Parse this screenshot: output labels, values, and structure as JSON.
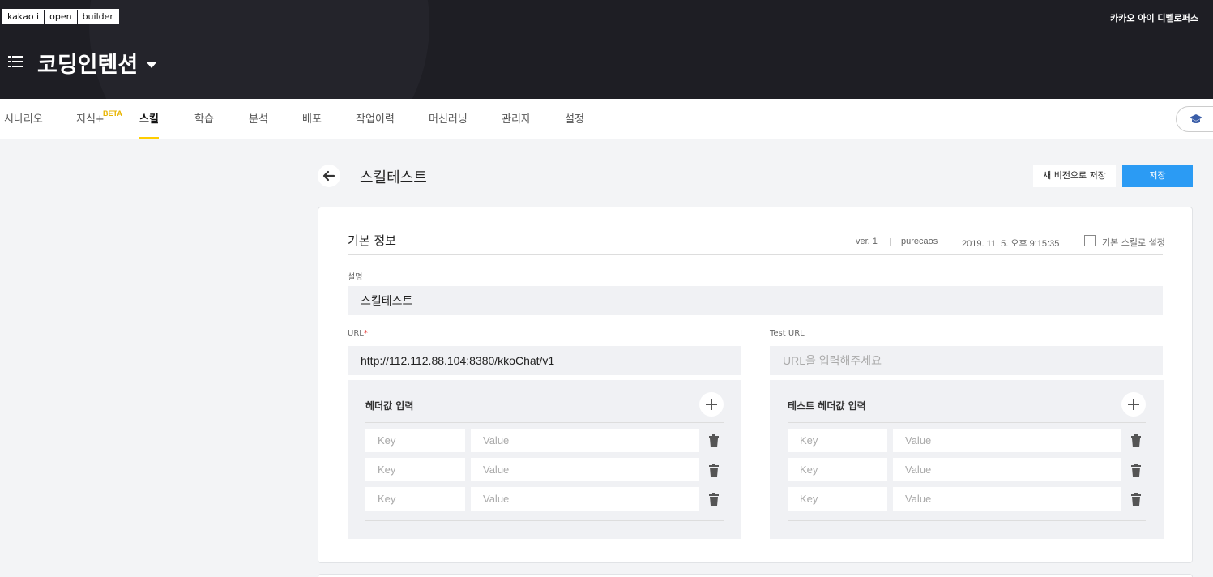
{
  "header": {
    "logo": [
      "kakao i",
      "open",
      "builder"
    ],
    "top_right": "카카오 아이 디벨로퍼스",
    "project_title": "코딩인텐션",
    "menu_icon": "list-icon",
    "dropdown_icon": "caret-down-icon"
  },
  "nav": {
    "items": [
      {
        "label": "시나리오"
      },
      {
        "label": "지식+"
      },
      {
        "label": "스킬",
        "active": true
      },
      {
        "label": "학습"
      },
      {
        "label": "분석"
      },
      {
        "label": "배포"
      },
      {
        "label": "작업이력"
      },
      {
        "label": "머신러닝"
      },
      {
        "label": "관리자"
      },
      {
        "label": "설정"
      }
    ],
    "beta_badge": "BETA",
    "help_icon": "graduation-cap-icon"
  },
  "page": {
    "title": "스킬테스트",
    "back_icon": "arrow-left-icon",
    "save_new_version_label": "새 비전으로 저장",
    "save_label": "저장"
  },
  "basic_info": {
    "title": "기본 정보",
    "version": "ver. 1",
    "author": "purecaos",
    "date": "2019. 11. 5. 오후 9:15:35",
    "default_skill_label": "기본 스킬로 설정",
    "default_skill_checked": false,
    "description_label": "설명",
    "description_value": "스킬테스트",
    "url_label": "URL",
    "url_required_mark": "*",
    "url_value": "http://112.112.88.104:8380/kkoChat/v1",
    "test_url_label": "Test URL",
    "test_url_placeholder": "URL을 입력해주세요"
  },
  "headers": {
    "title": "헤더값 입력",
    "rows": [
      {
        "key_placeholder": "Key",
        "value_placeholder": "Value"
      },
      {
        "key_placeholder": "Key",
        "value_placeholder": "Value"
      },
      {
        "key_placeholder": "Key",
        "value_placeholder": "Value"
      }
    ],
    "add_icon": "plus-icon",
    "delete_icon": "trash-icon"
  },
  "test_headers": {
    "title": "테스트 헤더값 입력",
    "rows": [
      {
        "key_placeholder": "Key",
        "value_placeholder": "Value"
      },
      {
        "key_placeholder": "Key",
        "value_placeholder": "Value"
      },
      {
        "key_placeholder": "Key",
        "value_placeholder": "Value"
      }
    ]
  },
  "colors": {
    "header_bg": "#1e1e24",
    "accent_yellow": "#ffcd00",
    "primary_blue": "#2b9bf4",
    "required_red": "#e53935"
  }
}
